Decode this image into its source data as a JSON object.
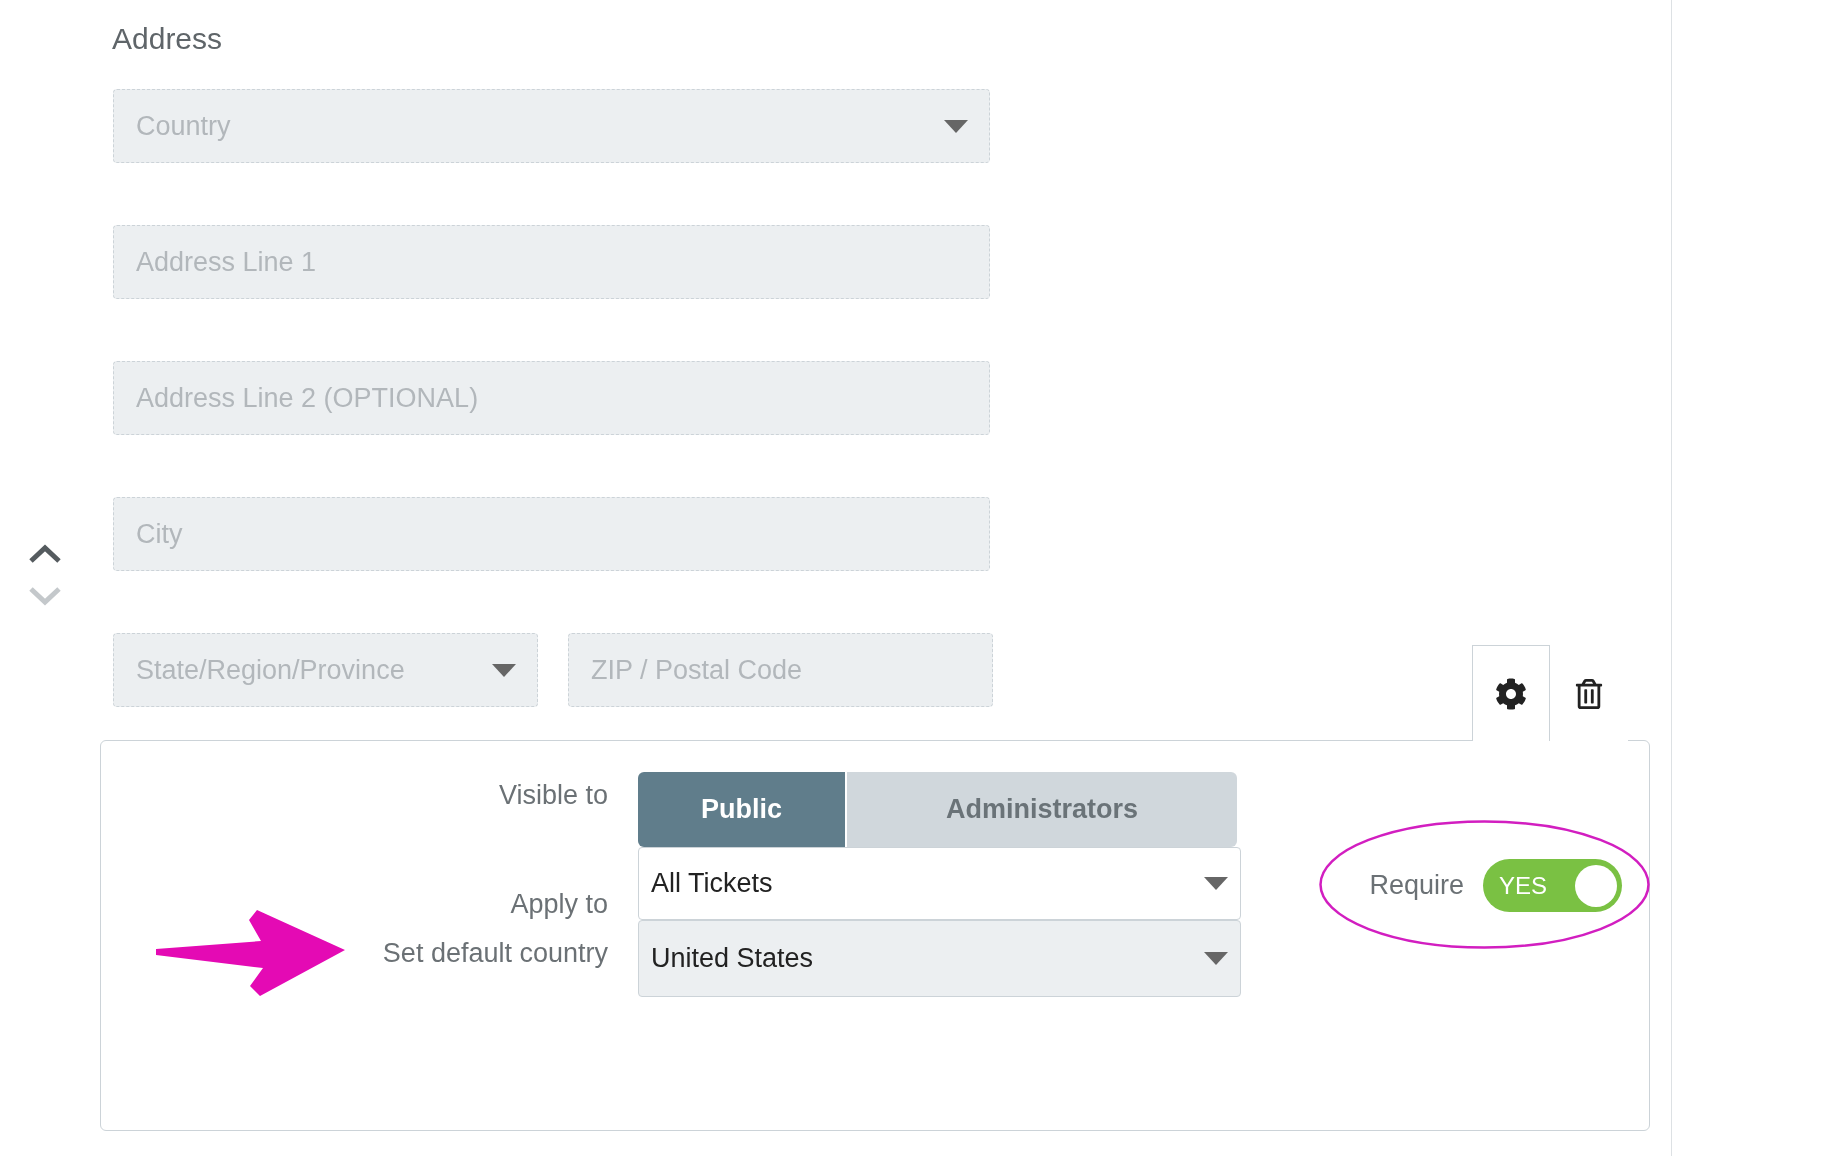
{
  "heading": "Address",
  "field_rows": [
    [
      {
        "kind": "select",
        "placeholder": "Country"
      }
    ],
    [
      {
        "kind": "text",
        "placeholder": "Address Line 1"
      }
    ],
    [
      {
        "kind": "text",
        "placeholder": "Address Line 2 (OPTIONAL)"
      }
    ],
    [
      {
        "kind": "text",
        "placeholder": "City"
      }
    ],
    [
      {
        "kind": "select",
        "placeholder": "State/Region/Province"
      },
      {
        "kind": "text",
        "placeholder": "ZIP / Postal Code"
      }
    ]
  ],
  "reorder": [
    {
      "kind": "up",
      "disabled": false
    },
    {
      "kind": "down",
      "disabled": true
    }
  ],
  "panel_tabs": [
    {
      "kind": "settings",
      "selected": true
    },
    {
      "kind": "delete",
      "selected": false
    }
  ],
  "settings": {
    "visible_to": {
      "label": "Visible to",
      "options": [
        {
          "label": "Public",
          "selected": true
        },
        {
          "label": "Administrators",
          "selected": false
        }
      ]
    },
    "apply_to": {
      "label": "Apply to",
      "value": "All Tickets"
    },
    "require": {
      "label": "Require",
      "on": true,
      "state_label": "YES"
    },
    "default_country": {
      "label": "Set default country",
      "value": "United States"
    }
  }
}
